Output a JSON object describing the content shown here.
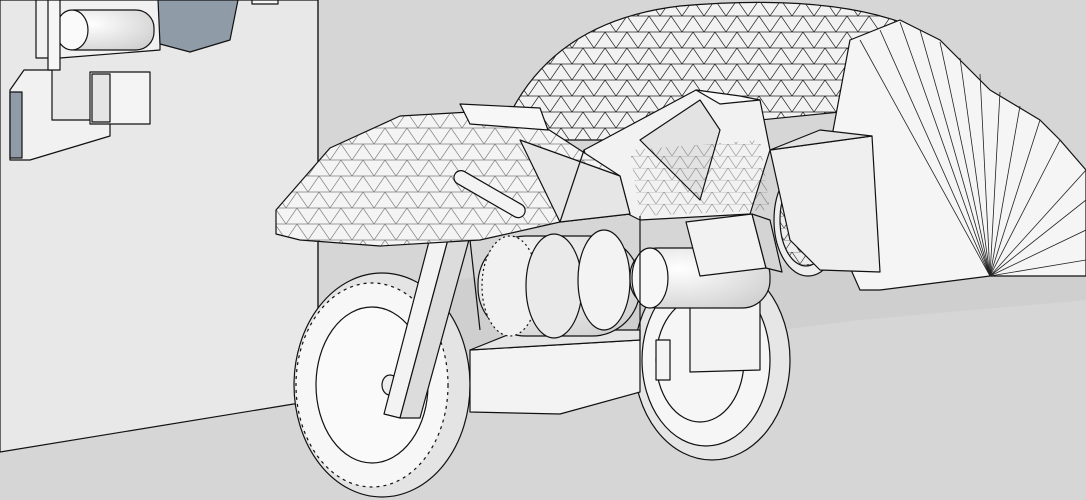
{
  "scene": {
    "background_color": "#d6d6d6",
    "wall_color": "#e9e9e9",
    "shadow_color": "#c8c8c8",
    "face_light": "#f4f4f4",
    "face_mid": "#e0e0e0",
    "face_dark": "#bdbdbd",
    "edge_color": "#111111",
    "accent_face": "#8f9ba6"
  }
}
